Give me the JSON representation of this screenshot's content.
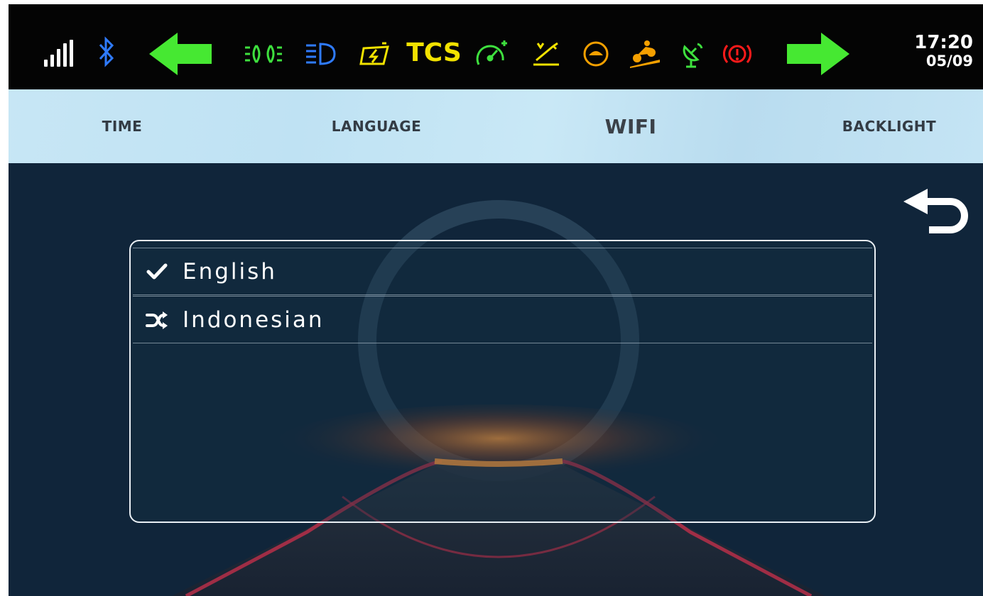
{
  "statusbar": {
    "signal_icon": "signal-bars-icon",
    "bluetooth_icon": "bluetooth-icon",
    "left_turn_icon": "turn-left-arrow-icon",
    "right_turn_icon": "turn-right-arrow-icon",
    "indicators": [
      {
        "name": "position-lights-icon",
        "color": "#3ee03e"
      },
      {
        "name": "high-beam-icon",
        "color": "#2f7bff"
      },
      {
        "name": "battery-charge-icon",
        "color": "#f2e200"
      },
      {
        "name": "tcs-indicator",
        "color": "#f2e200"
      },
      {
        "name": "cruise-speedometer-icon",
        "color": "#3ee03e"
      },
      {
        "name": "service-wrench-icon",
        "color": "#f2e200"
      },
      {
        "name": "eco-turtle-icon",
        "color": "#f5a000"
      },
      {
        "name": "hill-assist-motorcycle-icon",
        "color": "#f5a000"
      },
      {
        "name": "gps-satellite-icon",
        "color": "#3ee03e"
      },
      {
        "name": "brake-warning-icon",
        "color": "#ff1a1a"
      }
    ],
    "tcs_label": "TCS",
    "time": "17:20",
    "date": "05/09"
  },
  "tabs": [
    {
      "label": "TIME",
      "active": false
    },
    {
      "label": "LANGUAGE",
      "active": false
    },
    {
      "label": "WIFI",
      "active": true
    },
    {
      "label": "BACKLIGHT",
      "active": false
    }
  ],
  "back_icon": "back-return-arrow-icon",
  "languages": [
    {
      "label": "English",
      "icon": "checkmark-icon",
      "selected": true
    },
    {
      "label": "Indonesian",
      "icon": "shuffle-icon",
      "selected": false
    }
  ],
  "colors": {
    "background": "#0f2233",
    "tabbar": "#c7e6f5",
    "turn_arrow": "#46e832"
  }
}
